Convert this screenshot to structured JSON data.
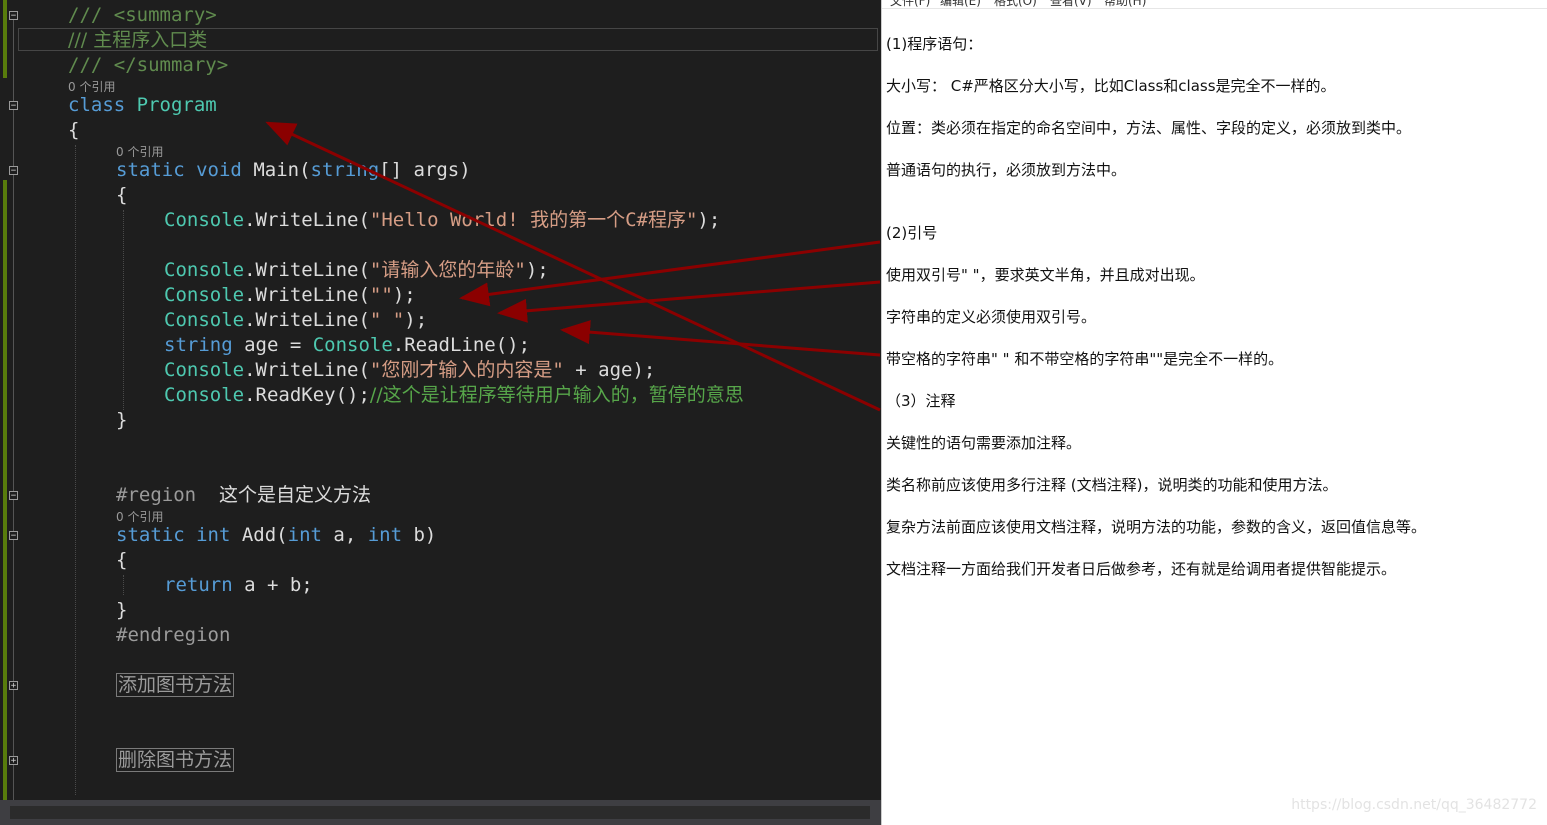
{
  "editor": {
    "lines": {
      "summary_open": "/// <summary>",
      "summary_text": "/// 主程序入口类",
      "summary_close": "/// </summary>",
      "class_kw": "class",
      "class_name": "Program",
      "brace_open": "{",
      "main_static": "static",
      "main_void": "void",
      "main_name": "Main(",
      "main_string": "string",
      "main_args": "[] args)",
      "main_brace_open": "{",
      "l1_type": "Console",
      "l1_call": ".WriteLine(",
      "l1_str": "\"Hello World! 我的第一个C#程序\"",
      "l1_end": ");",
      "l2_type": "Console",
      "l2_call": ".WriteLine(",
      "l2_str": "\"请输入您的年龄\"",
      "l2_end": ");",
      "l3_type": "Console",
      "l3_call": ".WriteLine(",
      "l3_str": "\"\"",
      "l3_end": ");",
      "l4_type": "Console",
      "l4_call": ".WriteLine(",
      "l4_str": "\" \"",
      "l4_end": ");",
      "l5_kw": "string",
      "l5_mid": " age = ",
      "l5_type": "Console",
      "l5_end": ".ReadLine();",
      "l6_type": "Console",
      "l6_call": ".WriteLine(",
      "l6_str": "\"您刚才输入的内容是\"",
      "l6_end": " + age);",
      "l7_type": "Console",
      "l7_call": ".ReadKey();",
      "l7_comment": "//这个是让程序等待用户输入的，暂停的意思",
      "main_brace_close": "}",
      "region_kw": "#region",
      "region_name": "这个是自定义方法",
      "add_static": "static",
      "add_int1": "int",
      "add_name": " Add(",
      "add_int2": "int",
      "add_a": " a, ",
      "add_int3": "int",
      "add_b": " b)",
      "add_brace_open": "{",
      "return_kw": "return",
      "return_expr": " a + b;",
      "add_brace_close": "}",
      "endregion_kw": "#endregion",
      "collapsed_add_book": "添加图书方法",
      "collapsed_delete_book": "删除图书方法"
    },
    "codelens": {
      "class_refs": "0 个引用",
      "main_refs": "0 个引用",
      "add_refs": "0 个引用"
    },
    "fold_collapse_glyph": "⊟",
    "fold_expand_glyph": "⊞",
    "arrow_color": "#8b0000"
  },
  "notepad": {
    "menu": [
      "文件(F)",
      "编辑(E)",
      "格式(O)",
      "查看(V)",
      "帮助(H)"
    ],
    "lines": [
      "(1)程序语句：",
      "大小写： C#严格区分大小写，比如Class和class是完全不一样的。",
      "位置：类必须在指定的命名空间中，方法、属性、字段的定义，必须放到类中。",
      "普通语句的执行，必须放到方法中。",
      "(2)引号",
      "使用双引号\" \"，要求英文半角，并且成对出现。",
      "字符串的定义必须使用双引号。",
      "带空格的字符串\" \" 和不带空格的字符串\"\"是完全不一样的。",
      "（3）注释",
      "关键性的语句需要添加注释。",
      "类名称前应该使用多行注释 (文档注释)，说明类的功能和使用方法。",
      "复杂方法前面应该使用文档注释，说明方法的功能，参数的含义，返回值信息等。",
      "文档注释一方面给我们开发者日后做参考，还有就是给调用者提供智能提示。"
    ],
    "watermark": "https://blog.csdn.net/qq_36482772"
  }
}
